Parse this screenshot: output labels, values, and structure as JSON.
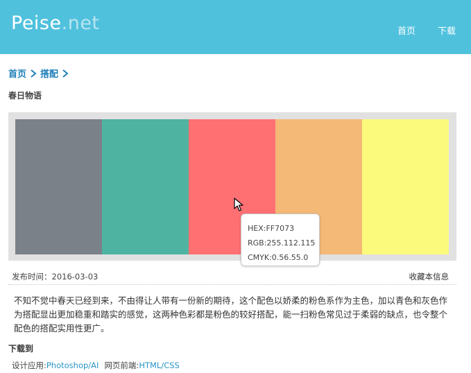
{
  "header": {
    "logo_part1": "Peise",
    "logo_part2": ".net",
    "nav": [
      {
        "label": "首页"
      },
      {
        "label": "下载"
      }
    ]
  },
  "breadcrumb": [
    {
      "label": "首页"
    },
    {
      "label": "搭配"
    }
  ],
  "page_title": "春日物语",
  "palette": [
    {
      "hex": "#7b8188"
    },
    {
      "hex": "#4fb3a1"
    },
    {
      "hex": "#ff7073"
    },
    {
      "hex": "#f4b877"
    },
    {
      "hex": "#fbfa7d"
    }
  ],
  "tooltip": {
    "hex": "HEX:FF7073",
    "rgb": "RGB:255.112.115",
    "cmyk": "CMYK:0.56.55.0"
  },
  "meta": {
    "date": "发布时间：2016-03-03",
    "favorite": "收藏本信息"
  },
  "description": "不知不觉中春天已经到来，不由得让人带有一份新的期待，这个配色以娇柔的粉色系作为主色，加以青色和灰色作为搭配显出更加稳重和踏实的感觉，这两种色彩都是粉色的较好搭配，能一扫粉色常见过于柔弱的缺点，也令整个配色的搭配实用性更广。",
  "download": {
    "title": "下载到",
    "design_label": "设计应用:",
    "design_link": "Photoshop/AI",
    "web_label": "网页前端:",
    "web_link": "HTML/CSS"
  }
}
